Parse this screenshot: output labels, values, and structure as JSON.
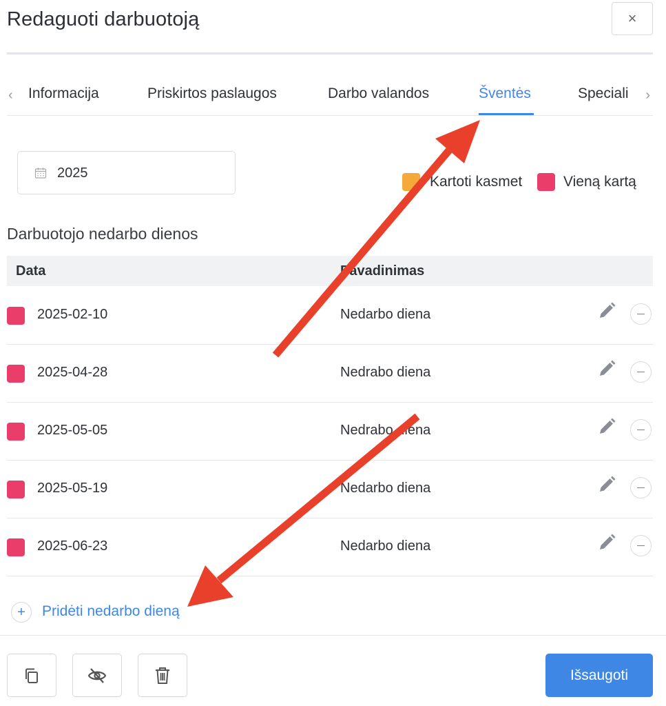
{
  "dialog": {
    "title": "Redaguoti darbuotoją",
    "close_glyph": "×"
  },
  "tabs": {
    "prev_glyph": "‹",
    "next_glyph": "›",
    "items": [
      {
        "label": "Informacija",
        "active": false
      },
      {
        "label": "Priskirtos paslaugos",
        "active": false
      },
      {
        "label": "Darbo valandos",
        "active": false
      },
      {
        "label": "Šventės",
        "active": true
      },
      {
        "label": "Speciali",
        "active": false
      }
    ]
  },
  "year_picker": {
    "value": "2025",
    "icon": "calendar-icon"
  },
  "legend": [
    {
      "label": "Kartoti kasmet",
      "color": "#f6a93b"
    },
    {
      "label": "Vieną kartą",
      "color": "#ea3d69"
    }
  ],
  "section_title": "Darbuotojo nedarbo dienos",
  "table": {
    "columns": [
      "Data",
      "Pavadinimas"
    ],
    "rows": [
      {
        "date": "2025-02-10",
        "name": "Nedarbo diena"
      },
      {
        "date": "2025-04-28",
        "name": "Nedrabo diena"
      },
      {
        "date": "2025-05-05",
        "name": "Nedrabo diena"
      },
      {
        "date": "2025-05-19",
        "name": "Nedarbo diena"
      },
      {
        "date": "2025-06-23",
        "name": "Nedarbo diena"
      }
    ]
  },
  "add_day": {
    "label": "Pridėti nedarbo dieną",
    "glyph": "+"
  },
  "footer": {
    "buttons": [
      "copy-icon",
      "eye-off-icon",
      "trash-icon"
    ],
    "save_label": "Išsaugoti"
  },
  "colors": {
    "accent": "#3f87e5",
    "once": "#ea3d69",
    "yearly": "#f6a93b",
    "annotation": "#e8402a"
  }
}
